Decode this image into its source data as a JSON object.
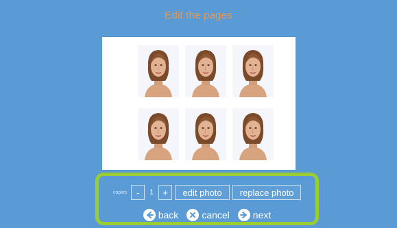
{
  "title": "Edit the pages",
  "sheet": {
    "photos": [
      "portrait-1",
      "portrait-2",
      "portrait-3",
      "portrait-4",
      "portrait-5",
      "portrait-6"
    ]
  },
  "toolbar": {
    "copies_label": "copies",
    "minus_label": "-",
    "copies_value": "1",
    "plus_label": "+",
    "edit_photo_label": "edit photo",
    "replace_photo_label": "replace photo"
  },
  "nav": {
    "back_label": "back",
    "cancel_label": "cancel",
    "next_label": "next"
  },
  "colors": {
    "background": "#5a9bd5",
    "title": "#e39a52",
    "highlight": "#9acd34"
  }
}
